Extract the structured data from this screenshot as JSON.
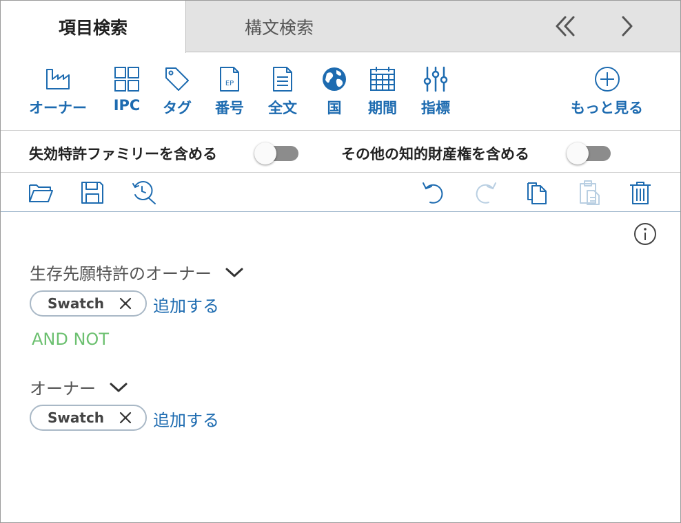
{
  "tabs": [
    {
      "label": "項目検索",
      "active": true
    },
    {
      "label": "構文検索",
      "active": false
    }
  ],
  "nav": {
    "collapse_icon": "double-chevron-left-icon",
    "next_icon": "chevron-right-icon"
  },
  "filters": [
    {
      "label": "オーナー",
      "icon": "factory-icon"
    },
    {
      "label": "IPC",
      "icon": "grid-icon"
    },
    {
      "label": "タグ",
      "icon": "tag-icon"
    },
    {
      "label": "番号",
      "icon": "ep-document-icon"
    },
    {
      "label": "全文",
      "icon": "document-icon"
    },
    {
      "label": "国",
      "icon": "globe-icon"
    },
    {
      "label": "期間",
      "icon": "calendar-icon"
    },
    {
      "label": "指標",
      "icon": "sliders-icon"
    },
    {
      "label": "もっと見る",
      "icon": "plus-circle-icon"
    }
  ],
  "toggles": [
    {
      "label": "失効特許ファミリーを含める",
      "on": false
    },
    {
      "label": "その他の知的財産権を含める",
      "on": false
    }
  ],
  "actions": [
    "open-folder-icon",
    "save-icon",
    "history-search-icon",
    "undo-icon",
    "redo-icon",
    "copy-icon",
    "paste-icon",
    "trash-icon"
  ],
  "criteria": [
    {
      "title": "生存先願特許のオーナー",
      "chips": [
        "Swatch"
      ],
      "add_label": "追加する"
    },
    {
      "title": "オーナー",
      "chips": [
        "Swatch"
      ],
      "add_label": "追加する"
    }
  ],
  "operator": "AND NOT",
  "colors": {
    "accent": "#1d6bb0",
    "operator": "#6cc070",
    "toggle_off": "#8c8c8c",
    "disabled": "#b9cfe2"
  }
}
